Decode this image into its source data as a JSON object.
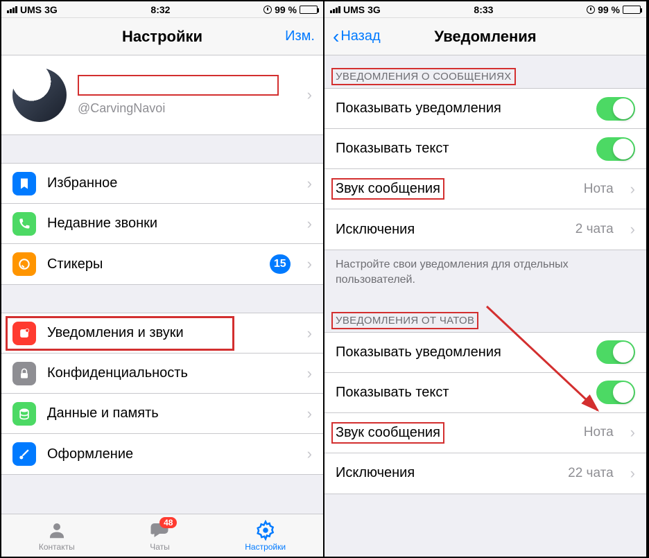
{
  "left": {
    "status": {
      "carrier": "UMS",
      "network": "3G",
      "time": "8:32",
      "battery_pct": "99 %"
    },
    "nav": {
      "title": "Настройки",
      "edit": "Изм."
    },
    "profile": {
      "handle": "@CarvingNavoi"
    },
    "rows1": {
      "fav": "Избранное",
      "calls": "Недавние звонки",
      "stickers": "Стикеры",
      "stickers_badge": "15"
    },
    "rows2": {
      "notif": "Уведомления и звуки",
      "privacy": "Конфиденциальность",
      "data": "Данные и память",
      "theme": "Оформление"
    },
    "tabs": {
      "contacts": "Контакты",
      "chats": "Чаты",
      "chats_badge": "48",
      "settings": "Настройки"
    }
  },
  "right": {
    "status": {
      "carrier": "UMS",
      "network": "3G",
      "time": "8:33",
      "battery_pct": "99 %"
    },
    "nav": {
      "back": "Назад",
      "title": "Уведомления"
    },
    "sections": {
      "msg_header": "УВЕДОМЛЕНИЯ О СООБЩЕНИЯХ",
      "msg_show": "Показывать уведомления",
      "msg_text": "Показывать текст",
      "msg_sound": "Звук сообщения",
      "msg_sound_val": "Нота",
      "msg_exc": "Исключения",
      "msg_exc_val": "2 чата",
      "footer": "Настройте свои уведомления для отдельных пользователей.",
      "chat_header": "УВЕДОМЛЕНИЯ ОТ ЧАТОВ",
      "chat_show": "Показывать уведомления",
      "chat_text": "Показывать текст",
      "chat_sound": "Звук сообщения",
      "chat_sound_val": "Нота",
      "chat_exc": "Исключения",
      "chat_exc_val": "22 чата"
    }
  }
}
